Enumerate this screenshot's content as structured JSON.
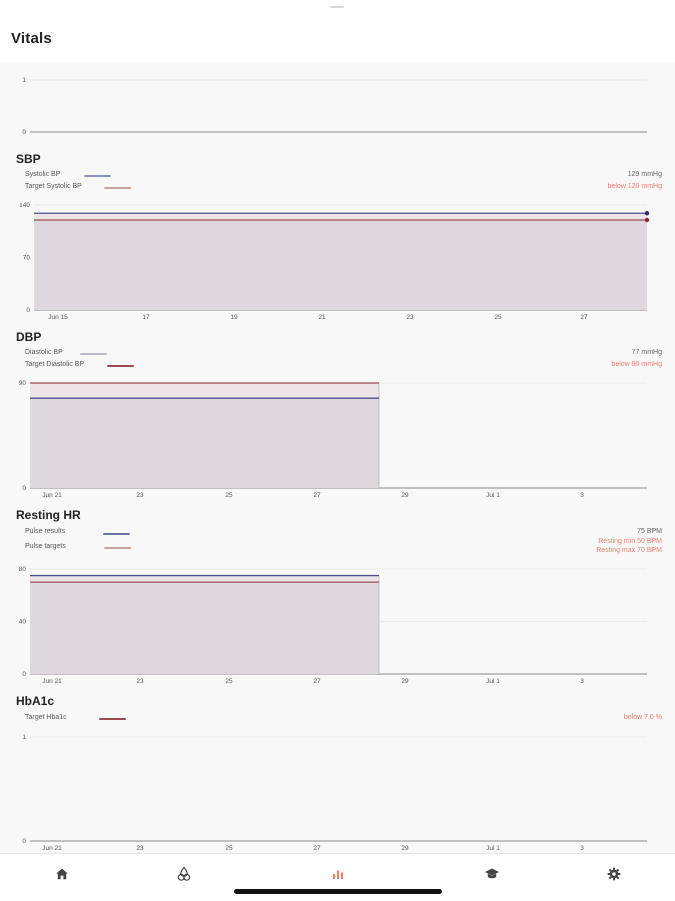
{
  "header": {
    "title": "Vitals"
  },
  "colors": {
    "measure": "#4a4f8c",
    "target": "#9b4a4f",
    "fill": "#ded8de",
    "target_text": "#e9826d",
    "active_tab": "#e9826d",
    "inactive_tab": "#444444"
  },
  "chart_data": [
    {
      "id": "top",
      "type": "line",
      "title": "",
      "yticks": [
        "1",
        "0"
      ],
      "xticks": [],
      "series": []
    },
    {
      "id": "sbp",
      "type": "area",
      "title": "SBP",
      "legend": [
        {
          "name": "Systolic BP",
          "color": "#8a8fc0"
        },
        {
          "name": "Target Systolic BP",
          "color": "#c9a0a0"
        }
      ],
      "current_value": "129 mmHg",
      "target_text": "below 120 mmHg",
      "yticks": [
        "140",
        "70",
        "0"
      ],
      "ylim": [
        0,
        140
      ],
      "xticks": [
        "Jun 15",
        "17",
        "19",
        "21",
        "23",
        "25",
        "27"
      ],
      "series": [
        {
          "name": "Systolic BP",
          "values": [
            129,
            129
          ]
        },
        {
          "name": "Target Systolic BP",
          "values": [
            120,
            120
          ]
        }
      ]
    },
    {
      "id": "dbp",
      "type": "area",
      "title": "DBP",
      "legend": [
        {
          "name": "Diastolic BP",
          "color": "#b8b8d0"
        },
        {
          "name": "Target Diastolic BP",
          "color": "#9b4a4f"
        }
      ],
      "current_value": "77 mmHg",
      "target_text": "below 90 mmHg",
      "yticks": [
        "90",
        "0"
      ],
      "ylim": [
        0,
        90
      ],
      "xticks": [
        "Jun 21",
        "23",
        "25",
        "27",
        "29",
        "Jul 1",
        "3"
      ],
      "series": [
        {
          "name": "Diastolic BP",
          "values": [
            77,
            77
          ]
        },
        {
          "name": "Target Diastolic BP",
          "values": [
            90,
            90
          ]
        }
      ]
    },
    {
      "id": "hr",
      "type": "area",
      "title": "Resting HR",
      "legend": [
        {
          "name": "Pulse results",
          "color": "#6a6fa8"
        },
        {
          "name": "Pulse targets",
          "color": "#c9a0a0"
        }
      ],
      "current_value": "75 BPM",
      "target_text": [
        "Resting min 50 BPM",
        "Resting max 70 BPM"
      ],
      "yticks": [
        "80",
        "40",
        "0"
      ],
      "ylim": [
        0,
        80
      ],
      "xticks": [
        "Jun 21",
        "23",
        "25",
        "27",
        "29",
        "Jul 1",
        "3"
      ],
      "series": [
        {
          "name": "Pulse results",
          "values": [
            75,
            75
          ]
        },
        {
          "name": "Pulse targets",
          "values": [
            70,
            70
          ]
        }
      ]
    },
    {
      "id": "hba1c",
      "type": "line",
      "title": "HbA1c",
      "legend": [
        {
          "name": "Target Hba1c",
          "color": "#9b4a4f"
        }
      ],
      "target_text": "below 7.0 %",
      "yticks": [
        "1",
        "0"
      ],
      "xticks": [
        "Jun 21",
        "23",
        "25",
        "27",
        "29",
        "Jul 1",
        "3"
      ],
      "series": []
    }
  ],
  "nav": [
    {
      "icon": "home-icon",
      "active": false
    },
    {
      "icon": "drops-icon",
      "active": false
    },
    {
      "icon": "chart-icon",
      "active": true
    },
    {
      "icon": "education-icon",
      "active": false
    },
    {
      "icon": "gear-icon",
      "active": false
    }
  ]
}
